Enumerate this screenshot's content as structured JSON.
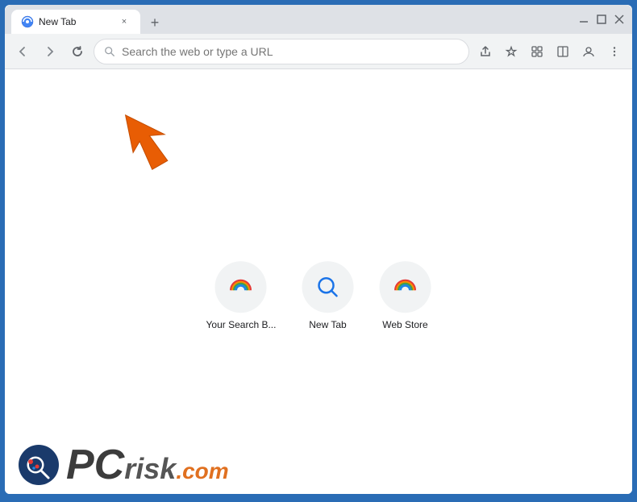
{
  "browser": {
    "tab": {
      "title": "New Tab",
      "favicon": "🌐",
      "close_label": "×"
    },
    "new_tab_label": "+",
    "window_controls": {
      "minimize": "—",
      "maximize": "□",
      "close": "✕"
    }
  },
  "navbar": {
    "back_label": "←",
    "forward_label": "→",
    "reload_label": "↻",
    "address_placeholder": "Search the web or type a URL",
    "address_value": "",
    "share_icon": "⬆",
    "star_icon": "☆",
    "extensions_icon": "⚙",
    "profile_icon": "◉",
    "menu_icon": "⋮"
  },
  "shortcuts": [
    {
      "label": "Your Search B...",
      "type": "rainbow"
    },
    {
      "label": "New Tab",
      "type": "search"
    },
    {
      "label": "Web Store",
      "type": "rainbow2"
    }
  ],
  "watermark": {
    "pc_text": "PC",
    "risk_text": "risk",
    "domain": ".com"
  }
}
